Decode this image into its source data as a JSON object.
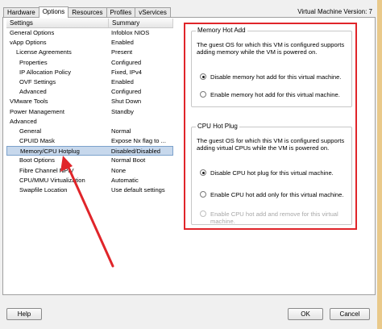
{
  "window": {
    "vm_version": "Virtual Machine Version: 7"
  },
  "tabs": [
    "Hardware",
    "Options",
    "Resources",
    "Profiles",
    "vServices"
  ],
  "settings": {
    "headers": [
      "Settings",
      "Summary"
    ],
    "rows": [
      {
        "setting": "General Options",
        "summary": "Infoblox NIOS"
      },
      {
        "setting": "vApp Options",
        "summary": "Enabled"
      },
      {
        "setting": "License Agreements",
        "summary": "Present"
      },
      {
        "setting": "Properties",
        "summary": "Configured"
      },
      {
        "setting": "IP Allocation Policy",
        "summary": "Fixed, IPv4"
      },
      {
        "setting": "OVF Settings",
        "summary": "Enabled"
      },
      {
        "setting": "Advanced",
        "summary": "Configured"
      },
      {
        "setting": "VMware Tools",
        "summary": "Shut Down"
      },
      {
        "setting": "Power Management",
        "summary": "Standby"
      },
      {
        "setting": "Advanced",
        "summary": ""
      },
      {
        "setting": "General",
        "summary": "Normal"
      },
      {
        "setting": "CPUID Mask",
        "summary": "Expose Nx flag to ..."
      },
      {
        "setting": "Memory/CPU Hotplug",
        "summary": "Disabled/Disabled"
      },
      {
        "setting": "Boot Options",
        "summary": "Normal Boot"
      },
      {
        "setting": "Fibre Channel NPIV",
        "summary": "None"
      },
      {
        "setting": "CPU/MMU Virtualization",
        "summary": "Automatic"
      },
      {
        "setting": "Swapfile Location",
        "summary": "Use default settings"
      }
    ]
  },
  "memory_hot_add": {
    "title": "Memory Hot Add",
    "description": "The guest OS for which this VM is configured supports adding memory while the VM is powered on.",
    "options": [
      {
        "label": "Disable memory hot add for this virtual machine.",
        "selected": true,
        "enabled": true
      },
      {
        "label": "Enable memory hot add for this virtual machine.",
        "selected": false,
        "enabled": true
      }
    ]
  },
  "cpu_hot_plug": {
    "title": "CPU Hot Plug",
    "description": "The guest OS for which this VM is configured supports adding virtual CPUs while the VM is powered on.",
    "options": [
      {
        "label": "Disable CPU hot plug for this virtual machine.",
        "selected": true,
        "enabled": true
      },
      {
        "label": "Enable CPU hot add only for this virtual machine.",
        "selected": false,
        "enabled": true
      },
      {
        "label": "Enable CPU hot add and remove for this virtual machine.",
        "selected": false,
        "enabled": false
      }
    ]
  },
  "buttons": {
    "help": "Help",
    "ok": "OK",
    "cancel": "Cancel"
  },
  "colors": {
    "highlight_box": "#e0252a",
    "arrow": "#e0252a",
    "selected_row": "#c7d8ec"
  }
}
